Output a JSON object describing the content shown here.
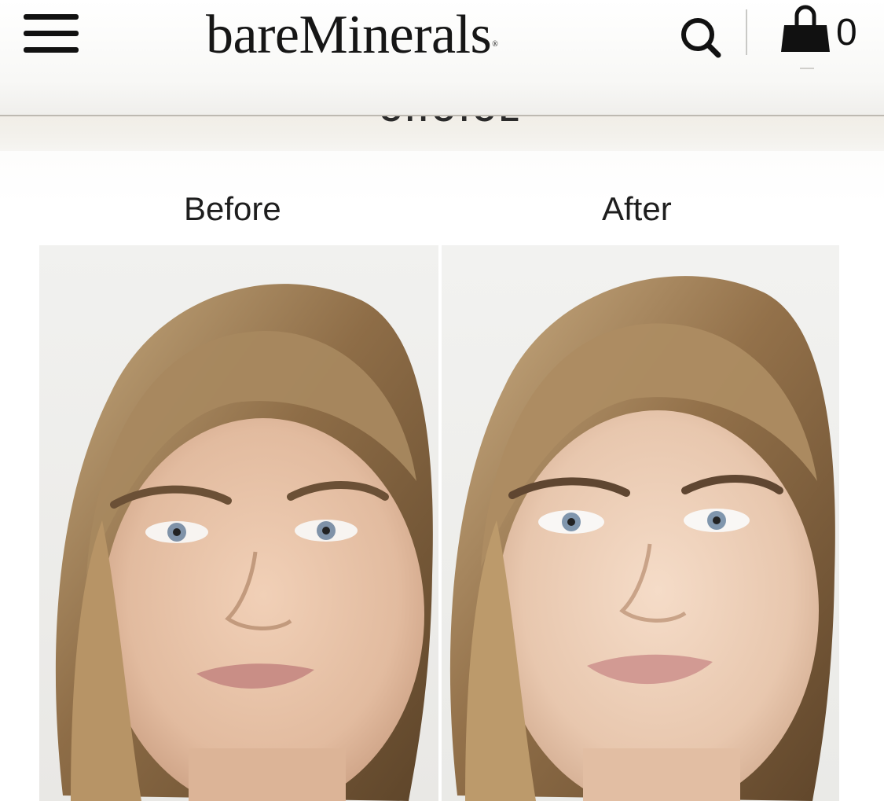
{
  "header": {
    "menu_icon": "hamburger-menu-icon",
    "logo_text": "bareMinerals",
    "logo_mark": "®",
    "search_icon": "search-icon",
    "cart_icon": "shopping-bag-icon",
    "cart_count": "0"
  },
  "section": {
    "heading": "CHOICE"
  },
  "comparison": {
    "before_label": "Before",
    "after_label": "After",
    "before_image": "before-portrait-image",
    "after_image": "after-portrait-image"
  },
  "colors": {
    "text": "#111111",
    "band": "#f2efe8",
    "rule": "#bdb9b1",
    "photo_background": "#eeeeec",
    "hair": "#a98c62",
    "skin": "#e8c4aa"
  }
}
